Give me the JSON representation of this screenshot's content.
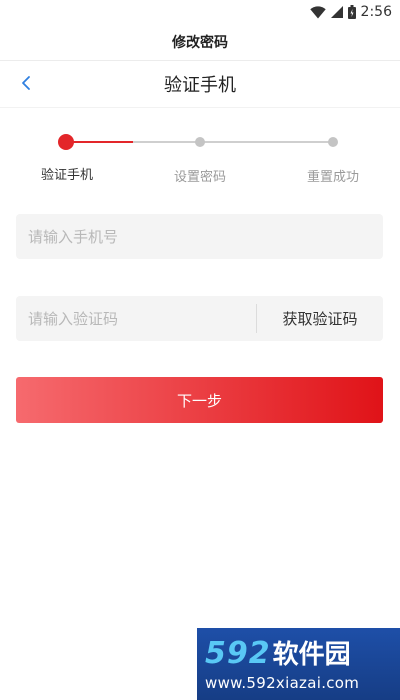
{
  "status_bar": {
    "time": "2:56",
    "icons": [
      "wifi-icon",
      "cell-signal-icon",
      "battery-icon"
    ]
  },
  "app_title": "修改密码",
  "nav": {
    "back_icon": "chevron-left-icon",
    "title": "验证手机"
  },
  "steps": {
    "current": 1,
    "items": [
      {
        "label": "验证手机"
      },
      {
        "label": "设置密码"
      },
      {
        "label": "重置成功"
      }
    ]
  },
  "form": {
    "phone_placeholder": "请输入手机号",
    "phone_value": "",
    "code_placeholder": "请输入验证码",
    "code_value": "",
    "get_code_label": "获取验证码"
  },
  "next_label": "下一步",
  "watermark": {
    "number": "592",
    "name": "软件园",
    "url": "www.592xiazai.com"
  },
  "colors": {
    "accent": "#e3262a",
    "button_gradient_start": "#f66a6e",
    "button_gradient_end": "#e01318",
    "inactive_step": "#c4c4c4",
    "field_background": "#f4f4f4"
  }
}
